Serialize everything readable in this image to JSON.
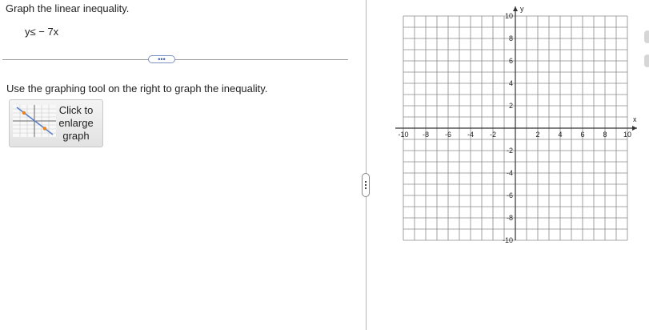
{
  "question": {
    "prompt": "Graph the linear inequality.",
    "inequality": "y≤ − 7x",
    "instruction": "Use the graphing tool on the right to graph the inequality."
  },
  "expand_button": {
    "label": "•••"
  },
  "enlarge_button": {
    "line1": "Click to",
    "line2": "enlarge",
    "line3": "graph",
    "icon": "graph-thumbnail-icon"
  },
  "graph": {
    "x_axis_label": "x",
    "y_axis_label": "y",
    "x_range": [
      -10,
      10
    ],
    "y_range": [
      -10,
      10
    ],
    "grid_step": 1,
    "x_tick_labels": [
      "-10",
      "-8",
      "-6",
      "-4",
      "-2",
      "2",
      "4",
      "6",
      "8",
      "10"
    ],
    "y_tick_labels": [
      "10",
      "8",
      "6",
      "4",
      "2",
      "-2",
      "-4",
      "-6",
      "-8",
      "-10"
    ],
    "grid_color": "#8a8a8a",
    "axis_color": "#333333"
  },
  "colors": {
    "divider": "#9a9a9a",
    "accent": "#7a93c4",
    "thumb_line": "#5b7fc7",
    "thumb_point": "#e8821a"
  }
}
